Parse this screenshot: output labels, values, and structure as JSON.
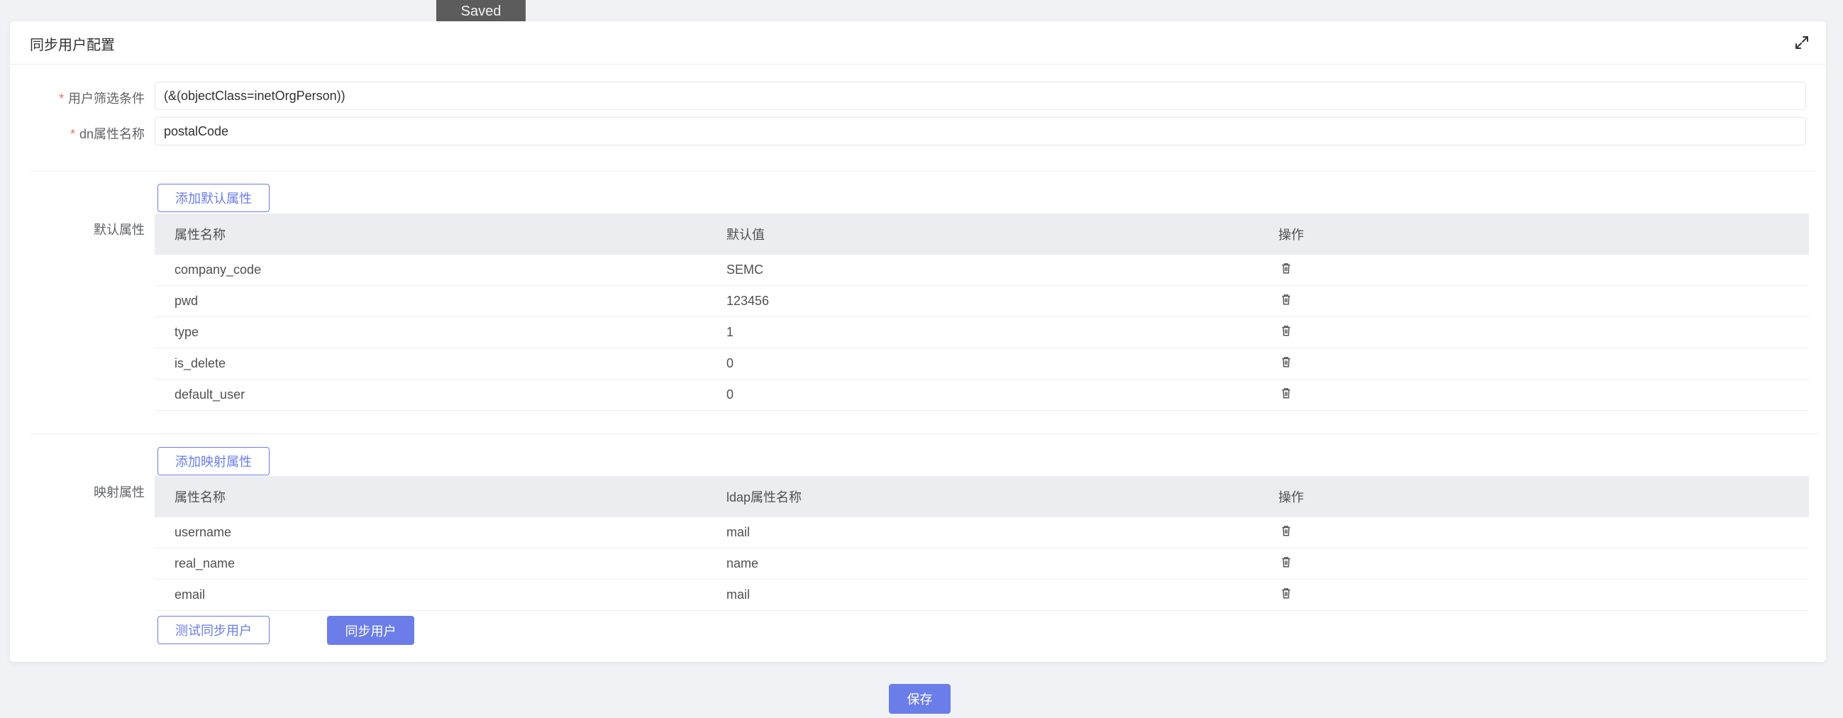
{
  "toast": {
    "text": "Saved"
  },
  "card": {
    "title": "同步用户配置",
    "expand_icon": "expand-icon"
  },
  "form": {
    "filter": {
      "label": "用户筛选条件",
      "value": "(&(objectClass=inetOrgPerson))"
    },
    "dn_attr": {
      "label": "dn属性名称",
      "value": "postalCode"
    }
  },
  "default_attrs": {
    "label": "默认属性",
    "add_button": "添加默认属性",
    "columns": [
      "属性名称",
      "默认值",
      "操作"
    ],
    "rows": [
      {
        "name": "company_code",
        "value": "SEMC"
      },
      {
        "name": "pwd",
        "value": "123456"
      },
      {
        "name": "type",
        "value": "1"
      },
      {
        "name": "is_delete",
        "value": "0"
      },
      {
        "name": "default_user",
        "value": "0"
      }
    ]
  },
  "mapping_attrs": {
    "label": "映射属性",
    "add_button": "添加映射属性",
    "columns": [
      "属性名称",
      "ldap属性名称",
      "操作"
    ],
    "rows": [
      {
        "name": "username",
        "value": "mail"
      },
      {
        "name": "real_name",
        "value": "name"
      },
      {
        "name": "email",
        "value": "mail"
      }
    ]
  },
  "actions": {
    "test_sync": "测试同步用户",
    "sync": "同步用户",
    "save": "保存"
  },
  "colors": {
    "primary": "#6b7de8",
    "required": "#f56c6c",
    "table_header_bg": "#ebedf1",
    "toast_bg": "#5c5c5c"
  }
}
